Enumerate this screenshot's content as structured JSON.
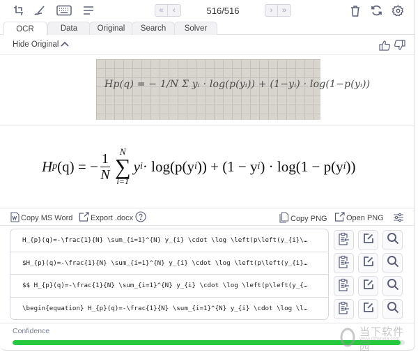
{
  "toolbar": {
    "icons": [
      "snip-screen-icon",
      "pen-draw-icon",
      "keyboard-icon",
      "menu-lines-icon"
    ],
    "right_icons": [
      "trash-icon",
      "refresh-icon",
      "gear-icon"
    ],
    "pager": {
      "first": "«",
      "prev": "‹",
      "next": "›",
      "last": "»",
      "count": "516/516"
    }
  },
  "tabs": [
    {
      "label": "OCR",
      "active": true
    },
    {
      "label": "Data",
      "active": false
    },
    {
      "label": "Original",
      "active": false
    },
    {
      "label": "Search",
      "active": false
    },
    {
      "label": "Solver",
      "active": false
    }
  ],
  "original": {
    "toggle_label": "Hide Original",
    "handwritten_text": "Hp(q) = − 1/N Σ yᵢ · log(p(yᵢ)) + (1−yᵢ) · log(1−p(yᵢ))"
  },
  "rendered": {
    "lhs": "H",
    "lhs_sub": "p",
    "lhs_arg": "(q) = −",
    "frac_num": "1",
    "frac_den": "N",
    "sum_upper": "N",
    "sum_symbol": "∑",
    "sum_lower": "i=1",
    "term1": "y",
    "sub_i": "i",
    "term2": " · log(p(y",
    "term3": ")) + (1 − y",
    "term4": ") · log(1 − p(y",
    "term5": "))"
  },
  "actions": {
    "copy_word": "Copy MS Word",
    "export_docx": "Export .docx",
    "copy_png": "Copy PNG",
    "open_png": "Open PNG"
  },
  "results": [
    "H_{p}(q)=-\\frac{1}{N} \\sum_{i=1}^{N} y_{i} \\cdot \\log \\left(p\\left(y_{i}\\…",
    "$H_{p}(q)=-\\frac{1}{N} \\sum_{i=1}^{N} y_{i} \\cdot \\log \\left(p\\left(y_{i}…",
    "$$ H_{p}(q)=-\\frac{1}{N} \\sum_{i=1}^{N} y_{i} \\cdot \\log \\left(p\\left(y_{…",
    "\\begin{equation} H_{p}(q)=-\\frac{1}{N} \\sum_{i=1}^{N} y_{i} \\cdot \\log \\l…"
  ],
  "confidence": {
    "label": "Confidence",
    "value_percent": 99,
    "color": "#27c93f"
  },
  "watermark": {
    "text": "当下软件园",
    "url_text": "www.downxia.com"
  },
  "colors": {
    "icon": "#5b6078",
    "border": "#d7d7dd"
  }
}
